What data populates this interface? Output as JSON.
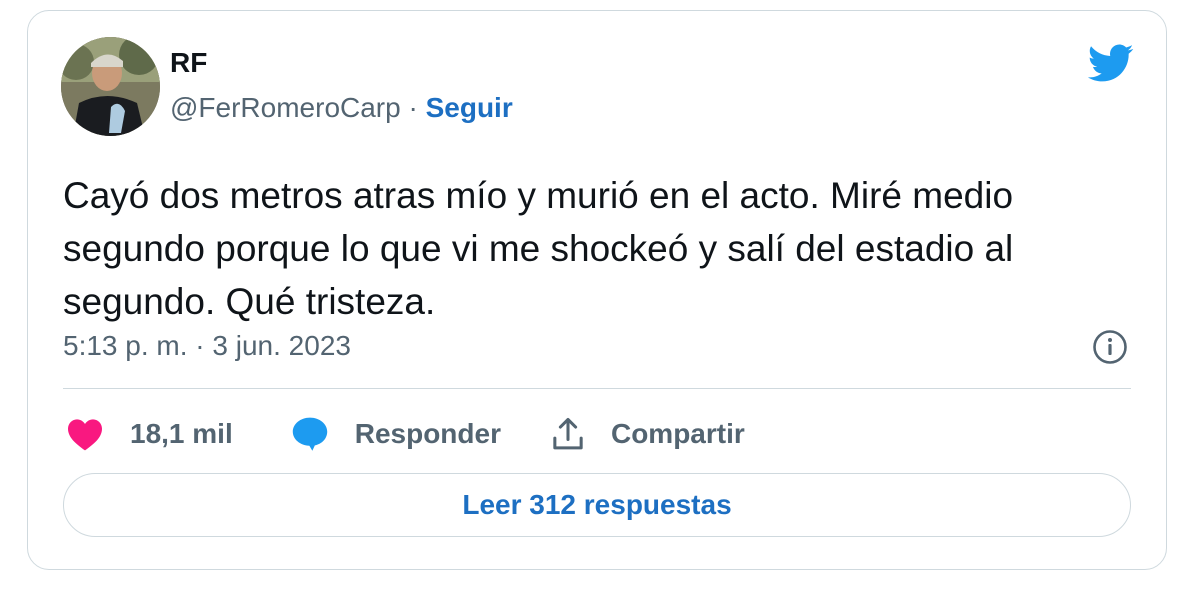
{
  "tweet": {
    "author_name": "RF",
    "handle": "@FerRomeroCarp",
    "separator": " · ",
    "follow_label": "Seguir",
    "text": "Cayó dos metros atras mío y murió en el acto. Miré medio segundo porque lo que vi me shockeó y salí del estadio al segundo. Qué tristeza.",
    "timestamp": "5:13 p. m. · 3 jun. 2023"
  },
  "actions": {
    "likes_count": "18,1 mil",
    "reply_label": "Responder",
    "share_label": "Compartir"
  },
  "read_replies_label": "Leer 312 respuestas",
  "icons": {
    "brand": "twitter-bird-icon",
    "info": "info-icon",
    "like": "heart-icon",
    "reply": "speech-bubble-icon",
    "share": "share-upload-icon"
  },
  "colors": {
    "twitter_blue": "#1d9bf0",
    "link_blue": "#1d6fc2",
    "like_pink": "#f91880",
    "secondary_text": "#536471",
    "border": "#cfd9de"
  }
}
